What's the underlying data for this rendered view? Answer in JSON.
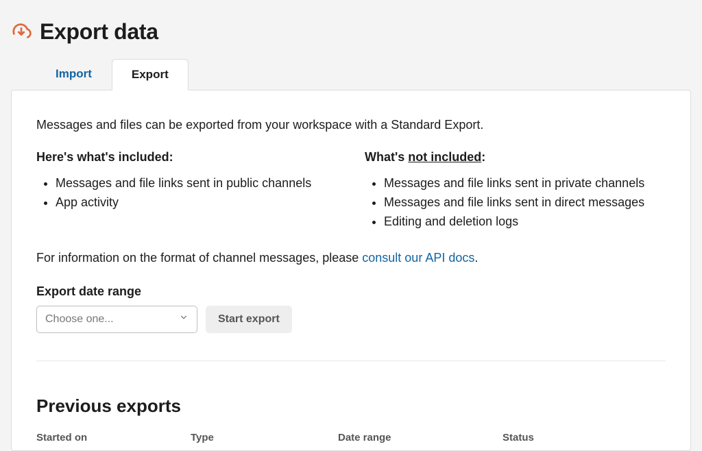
{
  "header": {
    "title": "Export data"
  },
  "tabs": {
    "import": {
      "label": "Import"
    },
    "export": {
      "label": "Export"
    }
  },
  "intro": "Messages and files can be exported from your workspace with a Standard Export.",
  "included": {
    "title": "Here's what's included:",
    "items": [
      "Messages and file links sent in public channels",
      "App activity"
    ]
  },
  "not_included": {
    "title_prefix": "What's ",
    "title_underlined": "not included",
    "title_suffix": ":",
    "items": [
      "Messages and file links sent in private channels",
      "Messages and file links sent in direct messages",
      "Editing and deletion logs"
    ]
  },
  "moreinfo": {
    "prefix": "For information on the format of channel messages, please ",
    "link": "consult our API docs",
    "suffix": "."
  },
  "form": {
    "label": "Export date range",
    "select_placeholder": "Choose one...",
    "button": "Start export"
  },
  "previous": {
    "title": "Previous exports",
    "columns": [
      "Started on",
      "Type",
      "Date range",
      "Status"
    ]
  }
}
